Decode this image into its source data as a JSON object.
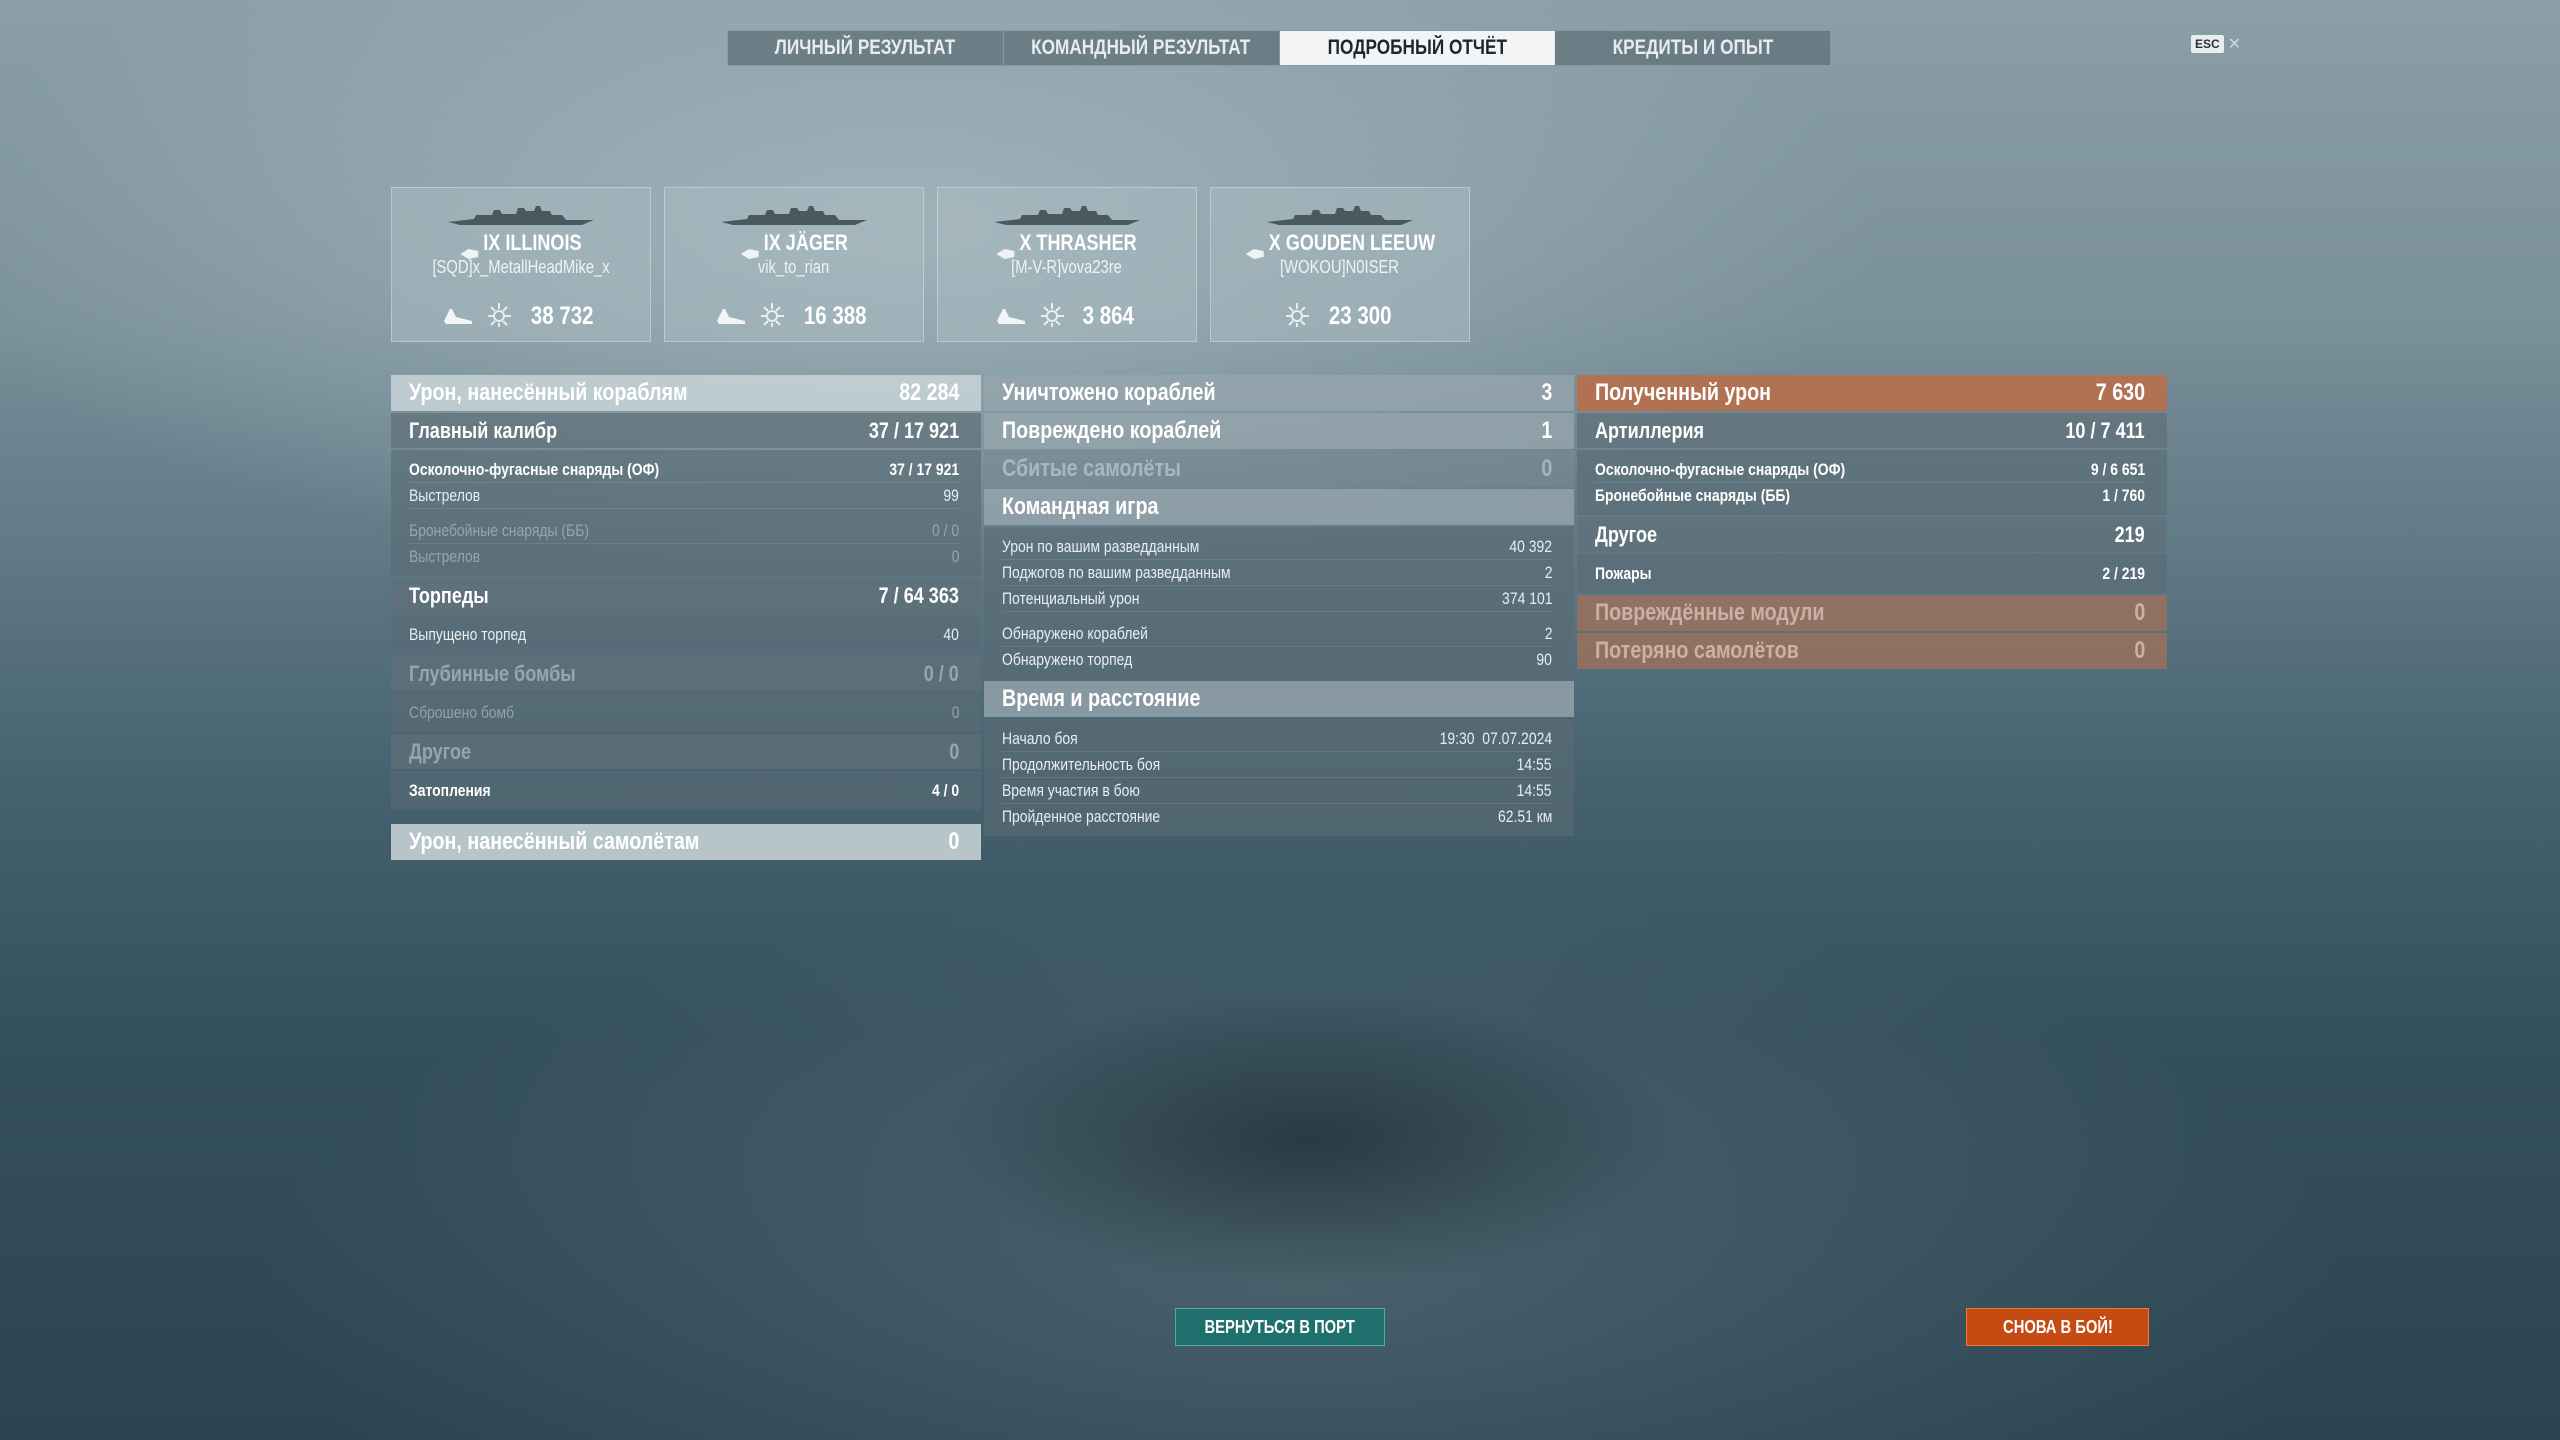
{
  "tabs": [
    {
      "label": "ЛИЧНЫЙ РЕЗУЛЬТАТ",
      "active": false
    },
    {
      "label": "КОМАНДНЫЙ РЕЗУЛЬТАТ",
      "active": false
    },
    {
      "label": "ПОДРОБНЫЙ ОТЧЁТ",
      "active": true
    },
    {
      "label": "КРЕДИТЫ И ОПЫТ",
      "active": false
    }
  ],
  "esc": {
    "key": "ESC",
    "close_icon": "close-icon"
  },
  "ships": [
    {
      "tier": "IX",
      "name": "ILLINOIS",
      "player": "[SQD]x_MetallHeadMike_x",
      "damage": "38 732",
      "has_kill_icon": true
    },
    {
      "tier": "IX",
      "name": "JÄGER",
      "player": "vik_to_rian",
      "damage": "16 388",
      "has_kill_icon": true
    },
    {
      "tier": "X",
      "name": "THRASHER",
      "player": "[M-V-R]vova23re",
      "damage": "3 864",
      "has_kill_icon": true
    },
    {
      "tier": "X",
      "name": "GOUDEN LEEUW",
      "player": "[WOKOU]N0ISER",
      "damage": "23 300",
      "has_kill_icon": false
    }
  ],
  "left": {
    "ship_damage": {
      "label": "Урон, нанесённый кораблям",
      "value": "82 284"
    },
    "main_battery": {
      "label": "Главный калибр",
      "hits": "37",
      "damage": "17 921"
    },
    "he": {
      "label": "Осколочно-фугасные снаряды (ОФ)",
      "hits": "37",
      "damage": "17 921"
    },
    "he_shots": {
      "label": "Выстрелов",
      "value": "99"
    },
    "ap": {
      "label": "Бронебойные снаряды (ББ)",
      "value": "0 / 0"
    },
    "ap_shots": {
      "label": "Выстрелов",
      "value": "0"
    },
    "torpedoes": {
      "label": "Торпеды",
      "hits": "7",
      "damage": "64 363"
    },
    "torp_launched": {
      "label": "Выпущено торпед",
      "value": "40"
    },
    "depth": {
      "label": "Глубинные бомбы",
      "value": "0 / 0"
    },
    "bombs_dropped": {
      "label": "Сброшено бомб",
      "value": "0"
    },
    "other": {
      "label": "Другое",
      "value": "0"
    },
    "flooding": {
      "label": "Затопления",
      "hits": "4",
      "damage": "0"
    },
    "plane_damage": {
      "label": "Урон, нанесённый самолётам",
      "value": "0"
    }
  },
  "middle": {
    "destroyed": {
      "label": "Уничтожено кораблей",
      "value": "3"
    },
    "damaged": {
      "label": "Повреждено кораблей",
      "value": "1"
    },
    "planes": {
      "label": "Сбитые самолёты",
      "value": "0"
    },
    "team_play": {
      "label": "Командная игра"
    },
    "spot_damage": {
      "label": "Урон по вашим разведданным",
      "value": "40 392"
    },
    "spot_fires": {
      "label": "Поджогов по вашим разведданным",
      "value": "2"
    },
    "potential": {
      "label": "Потенциальный урон",
      "value": "374 101"
    },
    "spotted_ships": {
      "label": "Обнаружено кораблей",
      "value": "2"
    },
    "spotted_torps": {
      "label": "Обнаружено торпед",
      "value": "90"
    },
    "time_dist": {
      "label": "Время и расстояние"
    },
    "start": {
      "label": "Начало боя",
      "value": "19:30  07.07.2024"
    },
    "duration": {
      "label": "Продолжительность боя",
      "value": "14:55"
    },
    "participation": {
      "label": "Время участия в бою",
      "value": "14:55"
    },
    "distance": {
      "label": "Пройденное расстояние",
      "value": "62.51 км"
    }
  },
  "right": {
    "received": {
      "label": "Полученный урон",
      "value": "7 630"
    },
    "artillery": {
      "label": "Артиллерия",
      "hits": "10",
      "damage": "7 411"
    },
    "he": {
      "label": "Осколочно-фугасные снаряды (ОФ)",
      "hits": "9",
      "damage": "6 651"
    },
    "ap": {
      "label": "Бронебойные снаряды (ББ)",
      "hits": "1",
      "damage": "760"
    },
    "other": {
      "label": "Другое",
      "value": "219"
    },
    "fires": {
      "label": "Пожары",
      "hits": "2",
      "damage": "219"
    },
    "modules": {
      "label": "Повреждённые модули",
      "value": "0"
    },
    "planes_lost": {
      "label": "Потеряно самолётов",
      "value": "0"
    }
  },
  "buttons": {
    "port": "ВЕРНУТЬСЯ В ПОРТ",
    "fight": "СНОВА В БОЙ!"
  },
  "colors": {
    "accent_orange": "#c64b12",
    "accent_teal": "#1f6f6c",
    "received_header": "#b6704e"
  }
}
